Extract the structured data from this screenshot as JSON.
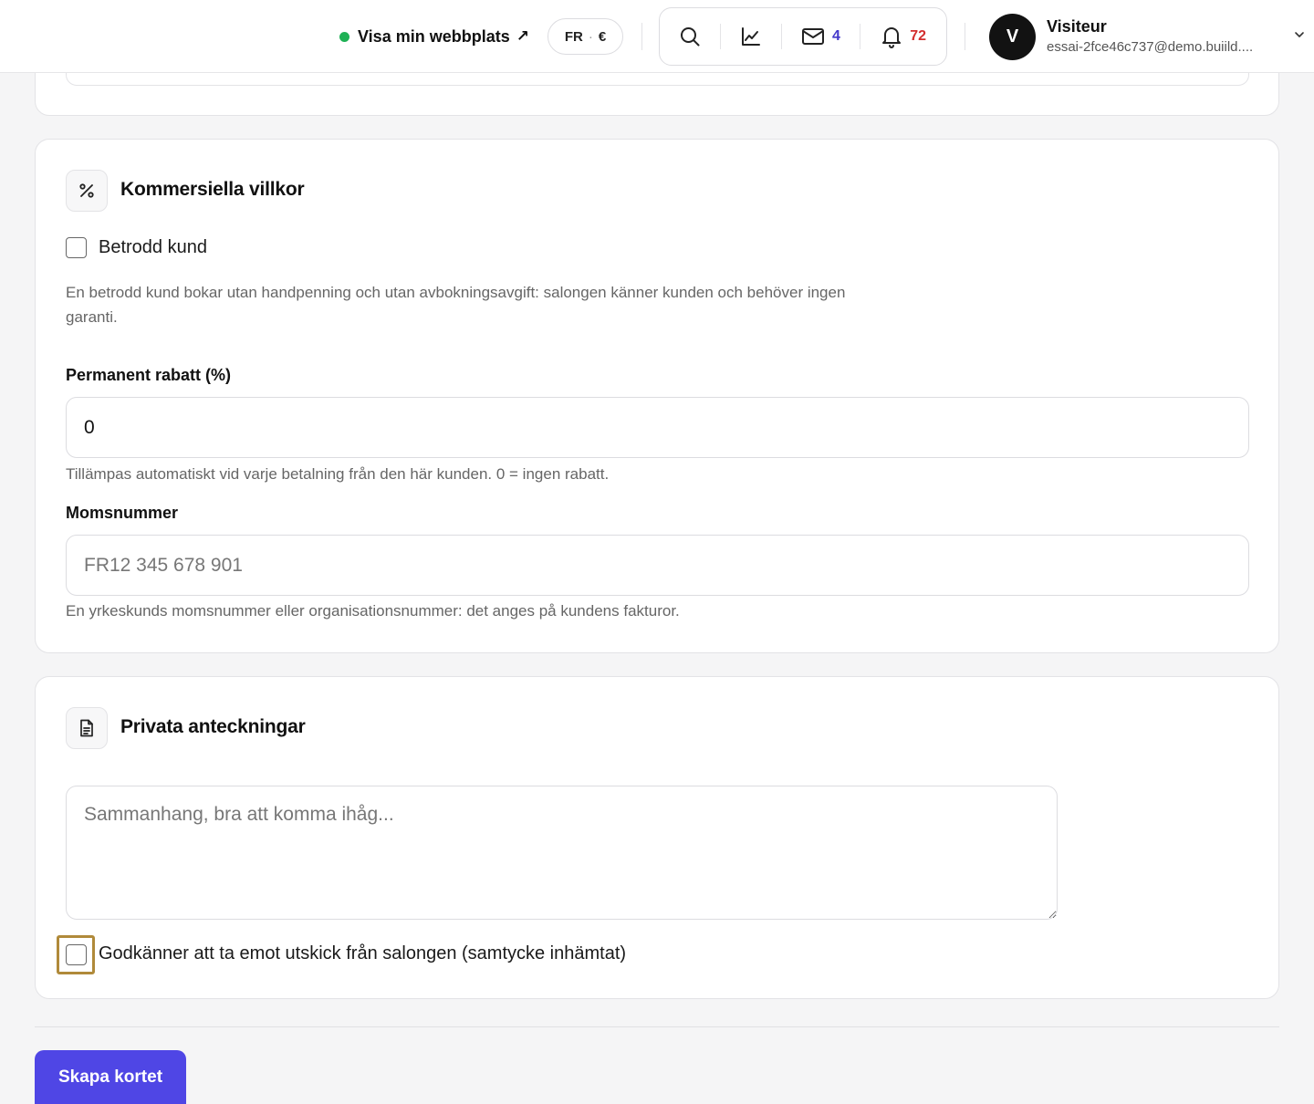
{
  "header": {
    "site_link_label": "Visa min webbplats",
    "site_link_arrow": "↗",
    "locale": "FR",
    "currency": "€",
    "messages_count": "4",
    "notifications_count": "72",
    "avatar_initial": "V",
    "user_name": "Visiteur",
    "user_email": "essai-2fce46c737@demo.buiild...."
  },
  "commercial": {
    "title": "Kommersiella villkor",
    "trusted_label": "Betrodd kund",
    "trusted_checked": false,
    "trusted_help": "En betrodd kund bokar utan handpenning och utan avbokningsavgift: salongen känner kunden och behöver ingen garanti.",
    "discount_label": "Permanent rabatt (%)",
    "discount_value": "0",
    "discount_help": "Tillämpas automatiskt vid varje betalning från den här kunden. 0 = ingen rabatt.",
    "vat_label": "Momsnummer",
    "vat_placeholder": "FR12 345 678 901",
    "vat_value": "",
    "vat_help": "En yrkeskunds momsnummer eller organisationsnummer: det anges på kundens fakturor."
  },
  "notes": {
    "title": "Privata anteckningar",
    "placeholder": "Sammanhang, bra att komma ihåg...",
    "value": "",
    "consent_label": "Godkänner att ta emot utskick från salongen (samtycke inhämtat)",
    "consent_checked": false
  },
  "actions": {
    "submit_label": "Skapa kortet"
  },
  "colors": {
    "accent": "#4f46e5",
    "status_online": "#1fb155",
    "messages_badge": "#4338ca",
    "notifications_badge": "#d32f2f",
    "focus_ring": "#b08a3a"
  }
}
